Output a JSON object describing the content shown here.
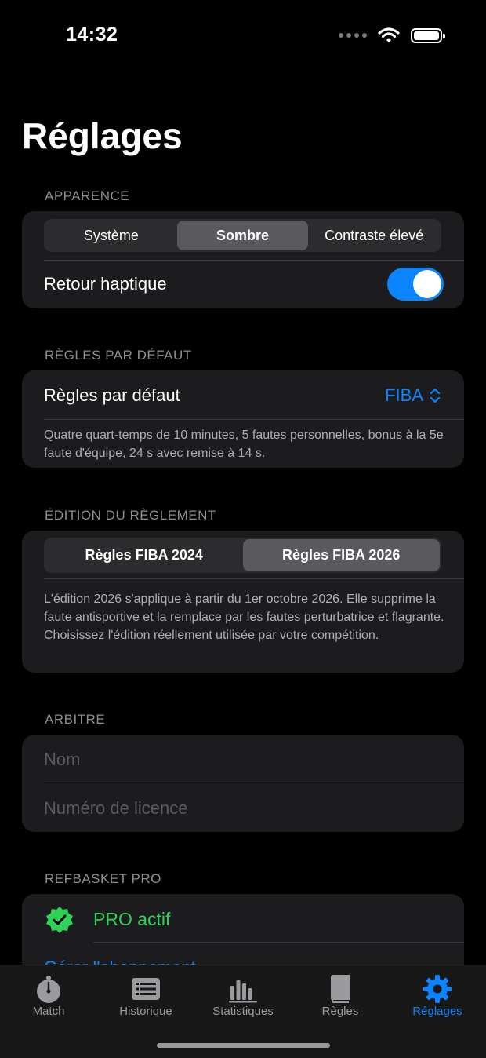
{
  "status": {
    "time": "14:32"
  },
  "title": "Réglages",
  "appearance": {
    "header": "APPARENCE",
    "segments": [
      "Système",
      "Sombre",
      "Contraste élevé"
    ],
    "selected": "Sombre",
    "haptic_label": "Retour haptique",
    "haptic_on": true
  },
  "default_rules": {
    "header": "RÈGLES PAR DÉFAUT",
    "label": "Règles par défaut",
    "value": "FIBA",
    "footnote": "Quatre quart-temps de 10 minutes, 5 fautes personnelles, bonus à la 5e faute d'équipe, 24 s avec remise à 14 s."
  },
  "edition": {
    "header": "ÉDITION DU RÈGLEMENT",
    "segments": [
      "Règles FIBA 2024",
      "Règles FIBA 2026"
    ],
    "selected": "Règles FIBA 2026",
    "footnote": "L'édition 2026 s'applique à partir du 1er octobre 2026. Elle supprime la faute antisportive et la remplace par les fautes perturbatrice et flagrante. Choisissez l'édition réellement utilisée par votre compétition."
  },
  "referee": {
    "header": "ARBITRE",
    "name_placeholder": "Nom",
    "license_placeholder": "Numéro de licence"
  },
  "pro": {
    "header": "REFBASKET PRO",
    "status": "PRO actif",
    "manage_link": "Gérer l'abonnement"
  },
  "tabs": [
    {
      "label": "Match",
      "icon": "stopwatch-icon"
    },
    {
      "label": "Historique",
      "icon": "history-list-icon"
    },
    {
      "label": "Statistiques",
      "icon": "bar-chart-icon"
    },
    {
      "label": "Règles",
      "icon": "book-icon"
    },
    {
      "label": "Réglages",
      "icon": "gear-icon"
    }
  ],
  "active_tab": "Réglages",
  "colors": {
    "accent": "#0a84ff",
    "pro_green": "#30d158",
    "card": "#1c1c1e"
  }
}
